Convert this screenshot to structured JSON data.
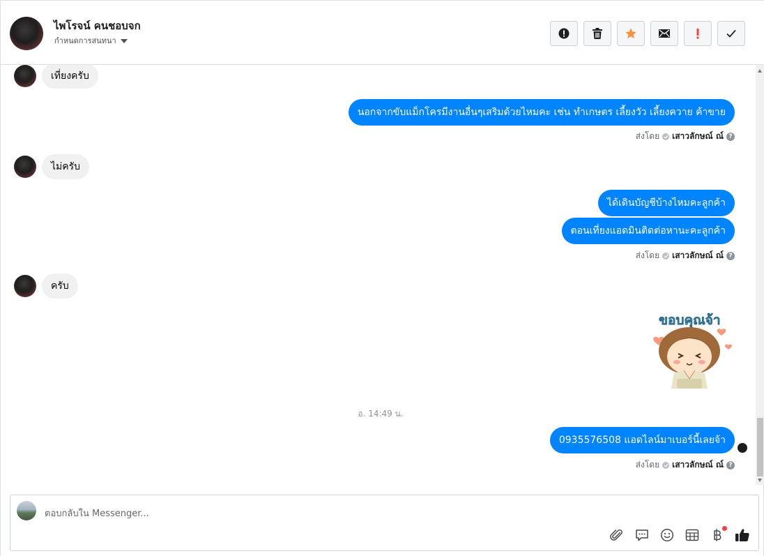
{
  "header": {
    "contact_name": "ไพโรจน์ คนชอบจก",
    "assign_label": "กำหนดการสนทนา",
    "actions": [
      {
        "name": "report-spam-button",
        "icon": "exclamation-circle-icon"
      },
      {
        "name": "delete-button",
        "icon": "trash-icon"
      },
      {
        "name": "star-button",
        "icon": "star-icon"
      },
      {
        "name": "mark-unread-button",
        "icon": "envelope-icon"
      },
      {
        "name": "follow-up-button",
        "icon": "exclamation-icon"
      },
      {
        "name": "mark-done-button",
        "icon": "checkmark-icon"
      }
    ],
    "star_color": "#f7923b",
    "followup_color": "#fa3e3e"
  },
  "messages": {
    "m1": "เที่ยงครับ",
    "m2": "นอกจากขับแม็กโครมีงานอื่นๆเสริมด้วยไหมคะ เช่น ทำเกษตร เลี้ยงวัว เลี้ยงควาย ค้าขาย",
    "m3": "ไม่ครับ",
    "m4": "ได้เดินบัญชีบ้างไหมคะลูกค้า",
    "m5": "ตอนเที่ยงแอดมินติดต่อหานะคะลูกค้า",
    "m6": "ครับ",
    "sticker_text": "ขอบคุณจ้า",
    "timestamp": "อ. 14:49 น.",
    "m7": "0935576508 แอดไลน์มาเบอร์นี้เลยจ้า"
  },
  "sent_by": {
    "prefix": "ส่งโดย",
    "agent": "เสาวลักษณ์ ณ์",
    "help": "?"
  },
  "reply": {
    "placeholder": "ตอบกลับใน Messenger...",
    "tools": [
      "paperclip-icon",
      "saved-reply-icon",
      "emoji-icon",
      "table-icon",
      "baht-icon",
      "thumbs-up-icon"
    ]
  },
  "colors": {
    "outgoing_bubble": "#0084ff",
    "incoming_bubble": "#f0f0f0"
  }
}
